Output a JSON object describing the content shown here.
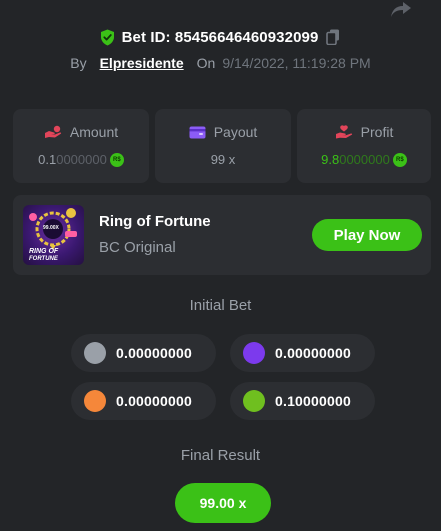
{
  "header": {
    "bet_id_label": "Bet ID: 85456646460932099",
    "by_label": "By",
    "username": "Elpresidente",
    "on_label": "On",
    "date": "9/14/2022, 11:19:28 PM",
    "share_icon": "share-icon",
    "copy_icon": "copy-icon",
    "verified_icon": "shield-check-icon"
  },
  "stats": {
    "amount": {
      "label": "Amount",
      "value_strong": "0.1",
      "value_faded": "0000000",
      "icon": "hand-coins-icon",
      "currency_badge": "R$"
    },
    "payout": {
      "label": "Payout",
      "value": "99 x",
      "icon": "wallet-icon"
    },
    "profit": {
      "label": "Profit",
      "value_strong": "9.8",
      "value_faded": "0000000",
      "icon": "hand-heart-icon",
      "currency_badge": "R$"
    }
  },
  "game": {
    "title": "Ring of Fortune",
    "subtitle": "BC Original",
    "play_label": "Play Now",
    "thumb_text_line1": "RING OF",
    "thumb_text_line2": "FORTUNE",
    "thumb_badge": "99.00X"
  },
  "initial_bet": {
    "title": "Initial Bet",
    "chips": [
      {
        "color": "#9aa0a8",
        "value": "0.00000000"
      },
      {
        "color": "#7c3aed",
        "value": "0.00000000"
      },
      {
        "color": "#f5873a",
        "value": "0.00000000"
      },
      {
        "color": "#6fbf1f",
        "value": "0.10000000"
      }
    ]
  },
  "final_result": {
    "title": "Final Result",
    "value": "99.00 x"
  },
  "colors": {
    "background": "#232528",
    "card": "#2c2e32",
    "accent_green": "#3bc117",
    "text_muted": "#9aa0a8"
  }
}
